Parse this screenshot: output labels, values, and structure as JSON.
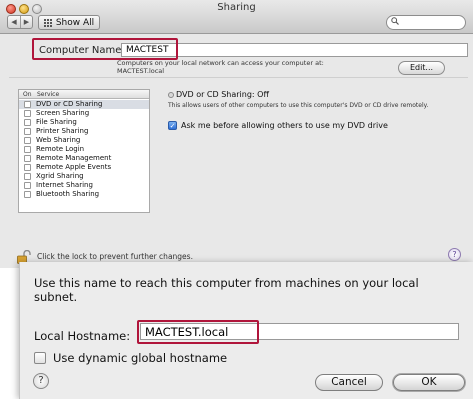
{
  "window": {
    "title": "Sharing",
    "show_all_label": "Show All",
    "back_glyph": "◀",
    "forward_glyph": "▶",
    "search_icon": "search-icon"
  },
  "computer_name": {
    "label": "Computer Name:",
    "value": "MACTEST",
    "network_text": "Computers on your local network can access your computer at: MACTEST.local",
    "edit_label": "Edit..."
  },
  "services": {
    "header_on": "On",
    "header_service": "Service",
    "items": [
      {
        "label": "DVD or CD Sharing",
        "checked": false,
        "selected": true
      },
      {
        "label": "Screen Sharing",
        "checked": false
      },
      {
        "label": "File Sharing",
        "checked": false
      },
      {
        "label": "Printer Sharing",
        "checked": false
      },
      {
        "label": "Web Sharing",
        "checked": false
      },
      {
        "label": "Remote Login",
        "checked": false
      },
      {
        "label": "Remote Management",
        "checked": false
      },
      {
        "label": "Remote Apple Events",
        "checked": false
      },
      {
        "label": "Xgrid Sharing",
        "checked": false
      },
      {
        "label": "Internet Sharing",
        "checked": false
      },
      {
        "label": "Bluetooth Sharing",
        "checked": false
      }
    ]
  },
  "detail": {
    "status": "DVD or CD Sharing: Off",
    "description": "This allows users of other computers to use this computer's DVD or CD drive remotely.",
    "ask_label": "Ask me before allowing others to use my DVD drive",
    "ask_checked": true
  },
  "lock": {
    "text": "Click the lock to prevent further changes."
  },
  "sheet": {
    "instruction": "Use this name to reach this computer from machines on your local subnet.",
    "hostname_label": "Local Hostname:",
    "hostname_value": "MACTEST.local",
    "dynamic_label": "Use dynamic global hostname",
    "cancel_label": "Cancel",
    "ok_label": "OK",
    "help_glyph": "?"
  },
  "colors": {
    "highlight": "#b0153b",
    "accent_blue": "#2e6fd6"
  }
}
